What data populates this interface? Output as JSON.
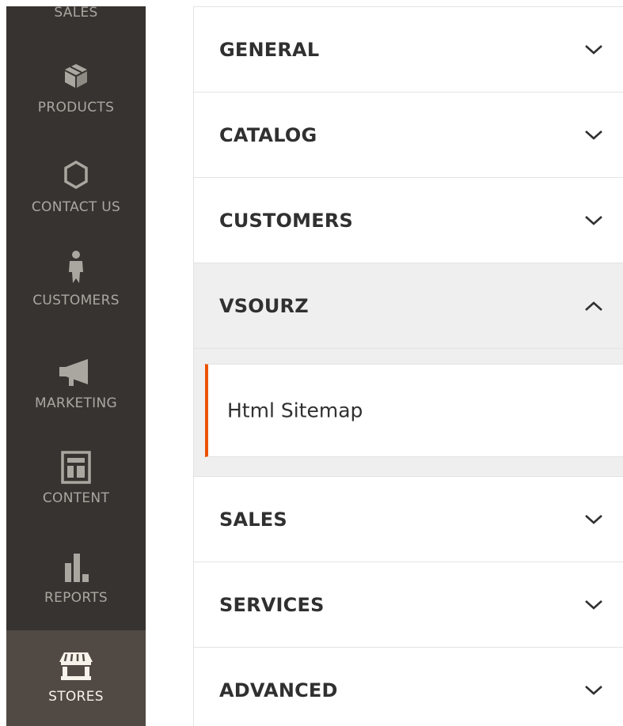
{
  "sidebar": {
    "items": [
      {
        "label": "SALES",
        "icon": "dollar-icon"
      },
      {
        "label": "PRODUCTS",
        "icon": "box-icon"
      },
      {
        "label": "CONTACT US",
        "icon": "hexagon-icon"
      },
      {
        "label": "CUSTOMERS",
        "icon": "person-icon"
      },
      {
        "label": "MARKETING",
        "icon": "megaphone-icon"
      },
      {
        "label": "CONTENT",
        "icon": "layout-icon"
      },
      {
        "label": "REPORTS",
        "icon": "bar-chart-icon"
      },
      {
        "label": "STORES",
        "icon": "storefront-icon",
        "active": true
      }
    ]
  },
  "config": {
    "sections": [
      {
        "title": "GENERAL",
        "expanded": false
      },
      {
        "title": "CATALOG",
        "expanded": false
      },
      {
        "title": "CUSTOMERS",
        "expanded": false
      },
      {
        "title": "VSOURZ",
        "expanded": true,
        "children": [
          {
            "label": "Html Sitemap",
            "active": true
          }
        ]
      },
      {
        "title": "SALES",
        "expanded": false
      },
      {
        "title": "SERVICES",
        "expanded": false
      },
      {
        "title": "ADVANCED",
        "expanded": false
      }
    ]
  },
  "colors": {
    "sidebar_bg": "#373330",
    "sidebar_active_bg": "#514943",
    "accent": "#eb5202",
    "open_section_bg": "#efefef"
  }
}
